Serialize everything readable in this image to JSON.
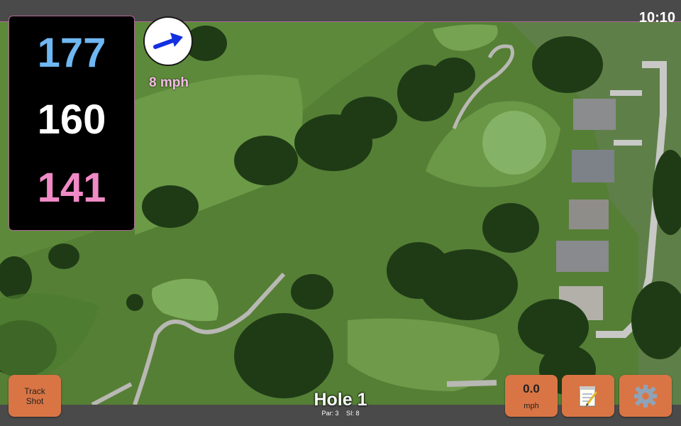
{
  "status": {
    "time": "10:10"
  },
  "distances": {
    "back": "177",
    "middle": "160",
    "front": "141"
  },
  "wind": {
    "speed_label": "8 mph",
    "direction_icon": "arrow-right-up-icon"
  },
  "hole": {
    "title": "Hole 1",
    "par_label": "Par: 3",
    "si_label": "SI: 8"
  },
  "buttons": {
    "track_shot": "Track Shot",
    "speed_value": "0.0",
    "speed_unit": "mph",
    "notes_icon": "notepad-icon",
    "settings_icon": "gear-icon"
  },
  "colors": {
    "back": "#6fb7f2",
    "middle": "#ffffff",
    "front": "#f08ac6",
    "button": "#d97545",
    "accent": "#b0679d"
  }
}
